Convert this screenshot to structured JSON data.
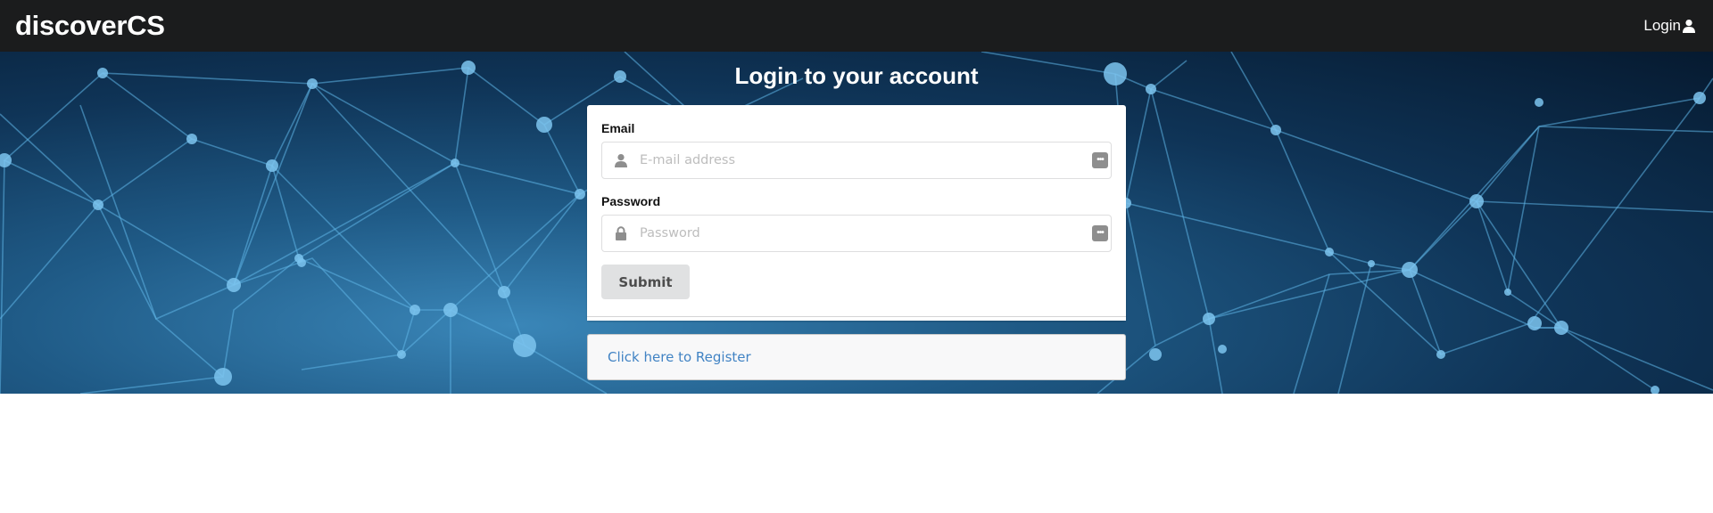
{
  "navbar": {
    "brand": "discoverCS",
    "login_label": "Login",
    "login_icon": "user-icon"
  },
  "main": {
    "title": "Login to your account"
  },
  "form": {
    "email_label": "Email",
    "email_placeholder": "E-mail address",
    "email_icon": "user-icon",
    "password_label": "Password",
    "password_placeholder": "Password",
    "password_icon": "lock-icon",
    "autofill_icon": "password-manager-icon",
    "submit_label": "Submit"
  },
  "register": {
    "link_text": "Click here to Register"
  },
  "colors": {
    "navbar_bg": "#1b1c1d",
    "link": "#4183c4",
    "button_bg": "#e0e1e2"
  }
}
